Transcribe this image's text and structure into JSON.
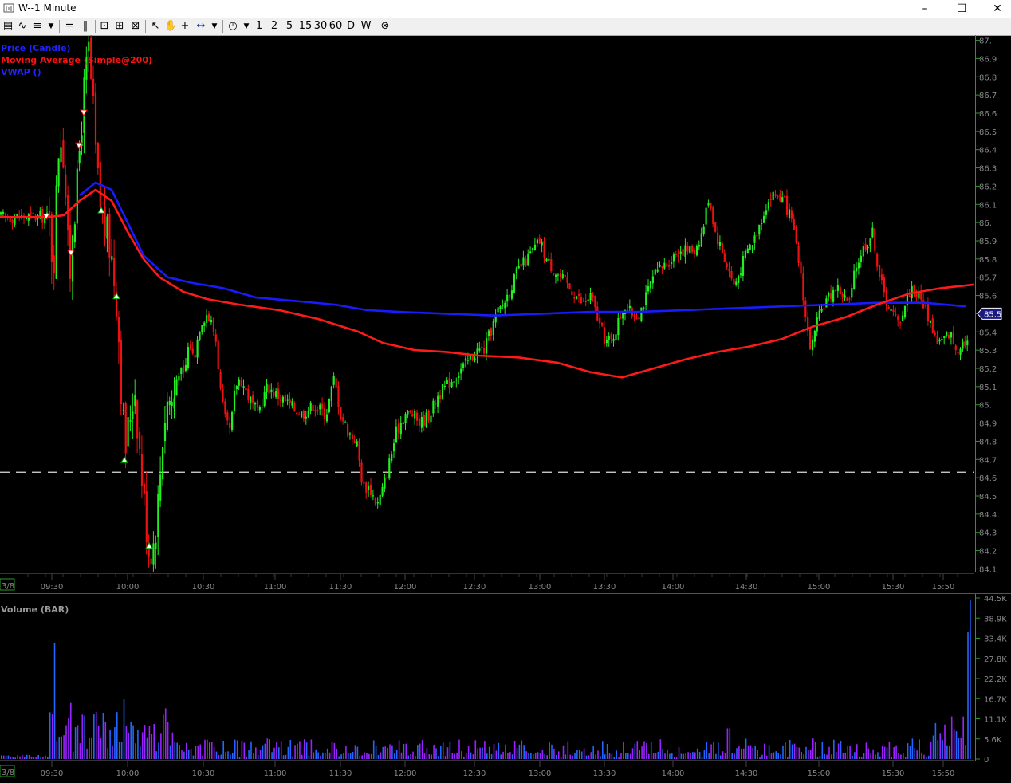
{
  "window": {
    "title": "W--1 Minute",
    "controls": [
      "minimize",
      "maximize",
      "close"
    ]
  },
  "toolbar": {
    "intervals": [
      "1",
      "2",
      "5",
      "15",
      "30",
      "60",
      "D",
      "W"
    ],
    "icons": [
      "bar-chart-icon",
      "line-chart-icon",
      "candle-style-icon",
      "dropdown-icon",
      "horizontal-line-icon",
      "vertical-line-icon",
      "zoom-fit-icon",
      "zoom-in-icon",
      "zoom-out-icon",
      "pointer-icon",
      "hand-icon",
      "crosshair-icon",
      "measure-icon",
      "dropdown-icon",
      "clock-icon",
      "dropdown-icon",
      "cancel-icon"
    ]
  },
  "colors": {
    "up": "#22ee22",
    "down": "#ee1111",
    "ma": "#ff1a1a",
    "vwap": "#1a1aff",
    "volume_a": "#9a22ff",
    "volume_b": "#2266ff",
    "axis": "#2a9a2a"
  },
  "legend": [
    {
      "label": "Price (Candle)",
      "color": "#2222ff"
    },
    {
      "label": "Moving Average (Simple@200)",
      "color": "#ff1111"
    },
    {
      "label": "VWAP ()",
      "color": "#2222ff"
    }
  ],
  "volume_label": "Volume (BAR)",
  "date_label": "3/8",
  "last_price": "85.5",
  "chart_data": [
    {
      "type": "candlestick",
      "title": "Price (Candle)",
      "y_ticks": [
        "87.",
        "86.9",
        "86.8",
        "86.7",
        "86.6",
        "86.5",
        "86.4",
        "86.3",
        "86.2",
        "86.1",
        "86.",
        "85.9",
        "85.8",
        "85.7",
        "85.6",
        "85.5",
        "85.4",
        "85.3",
        "85.2",
        "85.1",
        "85.",
        "84.9",
        "84.8",
        "84.7",
        "84.6",
        "84.5",
        "84.4",
        "84.3",
        "84.2",
        "84.1"
      ],
      "ylim": [
        84.08,
        87.02
      ],
      "x_ticks": [
        "09:30",
        "10:00",
        "10:30",
        "11:00",
        "11:30",
        "12:00",
        "12:30",
        "13:00",
        "13:30",
        "14:00",
        "14:30",
        "15:00",
        "15:30",
        "15:50"
      ],
      "horizontal_line": 84.63,
      "series": [
        {
          "name": "Price (Candle)",
          "path": [
            [
              0,
              86.03
            ],
            [
              60,
              86.03
            ],
            [
              66,
              85.75
            ],
            [
              72,
              86.4
            ],
            [
              76,
              86.5
            ],
            [
              80,
              86.3
            ],
            [
              86,
              85.65
            ],
            [
              90,
              86.0
            ],
            [
              96,
              86.2
            ],
            [
              100,
              86.5
            ],
            [
              104,
              86.7
            ],
            [
              110,
              86.95
            ],
            [
              116,
              86.6
            ],
            [
              120,
              86.3
            ],
            [
              126,
              86.05
            ],
            [
              132,
              85.95
            ],
            [
              138,
              85.85
            ],
            [
              146,
              85.55
            ],
            [
              152,
              85.0
            ],
            [
              156,
              84.75
            ],
            [
              162,
              84.95
            ],
            [
              168,
              85.1
            ],
            [
              174,
              84.75
            ],
            [
              180,
              84.45
            ],
            [
              186,
              84.2
            ],
            [
              192,
              84.25
            ],
            [
              198,
              84.5
            ],
            [
              204,
              84.9
            ],
            [
              210,
              85.05
            ],
            [
              216,
              85.0
            ],
            [
              222,
              85.2
            ],
            [
              230,
              85.15
            ],
            [
              236,
              85.35
            ],
            [
              242,
              85.25
            ],
            [
              250,
              85.45
            ],
            [
              258,
              85.5
            ],
            [
              264,
              85.45
            ],
            [
              270,
              85.35
            ],
            [
              276,
              85.05
            ],
            [
              282,
              84.9
            ],
            [
              288,
              84.85
            ],
            [
              294,
              85.1
            ],
            [
              300,
              85.15
            ],
            [
              310,
              85.05
            ],
            [
              322,
              84.95
            ],
            [
              334,
              85.1
            ],
            [
              348,
              85.05
            ],
            [
              362,
              85.0
            ],
            [
              378,
              84.95
            ],
            [
              392,
              85.0
            ],
            [
              408,
              84.95
            ],
            [
              418,
              85.15
            ],
            [
              426,
              84.95
            ],
            [
              436,
              84.85
            ],
            [
              446,
              84.8
            ],
            [
              454,
              84.55
            ],
            [
              462,
              84.55
            ],
            [
              472,
              84.45
            ],
            [
              480,
              84.55
            ],
            [
              488,
              84.7
            ],
            [
              496,
              84.85
            ],
            [
              506,
              84.95
            ],
            [
              516,
              84.95
            ],
            [
              526,
              84.9
            ],
            [
              538,
              84.95
            ],
            [
              548,
              85.05
            ],
            [
              558,
              85.1
            ],
            [
              568,
              85.15
            ],
            [
              578,
              85.2
            ],
            [
              588,
              85.25
            ],
            [
              598,
              85.3
            ],
            [
              606,
              85.3
            ],
            [
              614,
              85.4
            ],
            [
              622,
              85.5
            ],
            [
              630,
              85.55
            ],
            [
              640,
              85.65
            ],
            [
              650,
              85.75
            ],
            [
              660,
              85.8
            ],
            [
              668,
              85.85
            ],
            [
              676,
              85.9
            ],
            [
              684,
              85.8
            ],
            [
              692,
              85.75
            ],
            [
              702,
              85.7
            ],
            [
              712,
              85.65
            ],
            [
              722,
              85.6
            ],
            [
              730,
              85.55
            ],
            [
              740,
              85.6
            ],
            [
              750,
              85.45
            ],
            [
              758,
              85.35
            ],
            [
              766,
              85.35
            ],
            [
              774,
              85.45
            ],
            [
              782,
              85.55
            ],
            [
              790,
              85.5
            ],
            [
              800,
              85.5
            ],
            [
              810,
              85.6
            ],
            [
              818,
              85.7
            ],
            [
              828,
              85.75
            ],
            [
              840,
              85.8
            ],
            [
              850,
              85.85
            ],
            [
              860,
              85.85
            ],
            [
              870,
              85.85
            ],
            [
              880,
              85.95
            ],
            [
              888,
              86.15
            ],
            [
              896,
              85.95
            ],
            [
              904,
              85.85
            ],
            [
              912,
              85.75
            ],
            [
              920,
              85.65
            ],
            [
              928,
              85.75
            ],
            [
              936,
              85.85
            ],
            [
              944,
              85.9
            ],
            [
              952,
              86.0
            ],
            [
              960,
              86.1
            ],
            [
              968,
              86.15
            ],
            [
              976,
              86.15
            ],
            [
              984,
              86.1
            ],
            [
              992,
              86.0
            ],
            [
              998,
              85.85
            ],
            [
              1004,
              85.7
            ],
            [
              1010,
              85.45
            ],
            [
              1016,
              85.3
            ],
            [
              1024,
              85.45
            ],
            [
              1032,
              85.55
            ],
            [
              1040,
              85.6
            ],
            [
              1048,
              85.65
            ],
            [
              1056,
              85.6
            ],
            [
              1064,
              85.55
            ],
            [
              1072,
              85.75
            ],
            [
              1080,
              85.85
            ],
            [
              1088,
              85.9
            ],
            [
              1094,
              85.95
            ],
            [
              1100,
              85.75
            ],
            [
              1108,
              85.6
            ],
            [
              1118,
              85.5
            ],
            [
              1126,
              85.45
            ],
            [
              1134,
              85.55
            ],
            [
              1142,
              85.65
            ],
            [
              1150,
              85.6
            ],
            [
              1158,
              85.55
            ],
            [
              1166,
              85.45
            ],
            [
              1174,
              85.35
            ],
            [
              1182,
              85.35
            ],
            [
              1190,
              85.4
            ],
            [
              1198,
              85.3
            ],
            [
              1206,
              85.35
            ],
            [
              1214,
              85.35
            ]
          ]
        },
        {
          "name": "Moving Average (Simple@200)",
          "path": [
            [
              0,
              86.03
            ],
            [
              60,
              86.03
            ],
            [
              80,
              86.04
            ],
            [
              100,
              86.12
            ],
            [
              120,
              86.18
            ],
            [
              140,
              86.12
            ],
            [
              160,
              85.95
            ],
            [
              180,
              85.8
            ],
            [
              200,
              85.7
            ],
            [
              230,
              85.62
            ],
            [
              260,
              85.58
            ],
            [
              300,
              85.55
            ],
            [
              350,
              85.52
            ],
            [
              400,
              85.47
            ],
            [
              450,
              85.4
            ],
            [
              480,
              85.34
            ],
            [
              520,
              85.3
            ],
            [
              560,
              85.29
            ],
            [
              600,
              85.27
            ],
            [
              650,
              85.26
            ],
            [
              700,
              85.23
            ],
            [
              740,
              85.18
            ],
            [
              780,
              85.15
            ],
            [
              820,
              85.2
            ],
            [
              860,
              85.25
            ],
            [
              900,
              85.29
            ],
            [
              940,
              85.32
            ],
            [
              980,
              85.36
            ],
            [
              1020,
              85.43
            ],
            [
              1060,
              85.48
            ],
            [
              1100,
              85.55
            ],
            [
              1140,
              85.61
            ],
            [
              1180,
              85.64
            ],
            [
              1221,
              85.66
            ]
          ]
        },
        {
          "name": "VWAP ()",
          "path": [
            [
              100,
              86.15
            ],
            [
              120,
              86.22
            ],
            [
              140,
              86.18
            ],
            [
              160,
              86.0
            ],
            [
              180,
              85.82
            ],
            [
              210,
              85.7
            ],
            [
              240,
              85.67
            ],
            [
              280,
              85.64
            ],
            [
              320,
              85.59
            ],
            [
              370,
              85.57
            ],
            [
              420,
              85.55
            ],
            [
              460,
              85.52
            ],
            [
              500,
              85.51
            ],
            [
              560,
              85.5
            ],
            [
              620,
              85.49
            ],
            [
              680,
              85.5
            ],
            [
              740,
              85.51
            ],
            [
              800,
              85.51
            ],
            [
              860,
              85.52
            ],
            [
              920,
              85.53
            ],
            [
              980,
              85.54
            ],
            [
              1040,
              85.55
            ],
            [
              1100,
              85.56
            ],
            [
              1160,
              85.56
            ],
            [
              1212,
              85.54
            ]
          ]
        }
      ],
      "markers": [
        {
          "kind": "down",
          "x": 58,
          "y": 86.03
        },
        {
          "kind": "down",
          "x": 89,
          "y": 85.83
        },
        {
          "kind": "down",
          "x": 99,
          "y": 86.42
        },
        {
          "kind": "down",
          "x": 105,
          "y": 86.6
        },
        {
          "kind": "up",
          "x": 127,
          "y": 86.07
        },
        {
          "kind": "up",
          "x": 146,
          "y": 85.6
        },
        {
          "kind": "up",
          "x": 156,
          "y": 84.7
        },
        {
          "kind": "up",
          "x": 187,
          "y": 84.23
        }
      ]
    },
    {
      "type": "bar",
      "title": "Volume (BAR)",
      "y_ticks": [
        "44.5K",
        "38.9K",
        "33.4K",
        "27.8K",
        "22.2K",
        "16.7K",
        "11.1K",
        "5.6K",
        "0"
      ],
      "ylim": [
        0,
        44500
      ],
      "spikes": [
        {
          "x": 67,
          "value": 32000
        },
        {
          "x": 89,
          "value": 15500
        },
        {
          "x": 119,
          "value": 13000
        },
        {
          "x": 156,
          "value": 16500
        },
        {
          "x": 206,
          "value": 14000
        },
        {
          "x": 913,
          "value": 8500
        },
        {
          "x": 1215,
          "value": 44000
        },
        {
          "x": 1212,
          "value": 35000
        }
      ]
    }
  ]
}
